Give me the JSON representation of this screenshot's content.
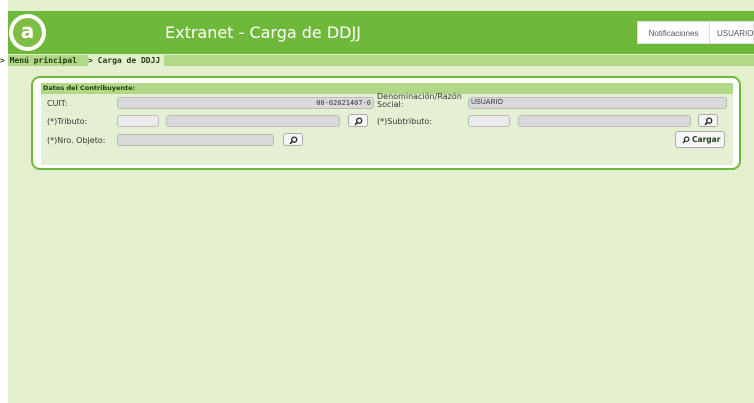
{
  "header": {
    "logo_letter": "a",
    "title": "Extranet - Carga de DDJJ",
    "notifications_label": "Notificaciones",
    "user_label": "USUARIO"
  },
  "breadcrumb": {
    "root": "> Menú principal",
    "current": "> Carga de DDJJ"
  },
  "form": {
    "section_title": "Datos del Contribuyente:",
    "cuit_label": "CUIT:",
    "cuit_value": "00-02021407-0",
    "denominacion_label_line1": "Denominación/Razón",
    "denominacion_label_line2": "Social:",
    "denominacion_value": "USUARIO",
    "tributo_label": "(*)Tributo:",
    "tributo_code": "",
    "tributo_desc": "",
    "subtributo_label": "(*)Subtributo:",
    "subtributo_code": "",
    "subtributo_desc": "",
    "objeto_label": "(*)Nro. Objeto:",
    "objeto_value": "",
    "cargar_label": "Cargar"
  },
  "colors": {
    "header_green": "#6fb93a",
    "breadcrumb_green": "#b1d887",
    "page_background": "#e4efce",
    "form_background": "#e5efd3"
  },
  "icons": {
    "search": "search-icon",
    "logo": "logo-icon"
  }
}
